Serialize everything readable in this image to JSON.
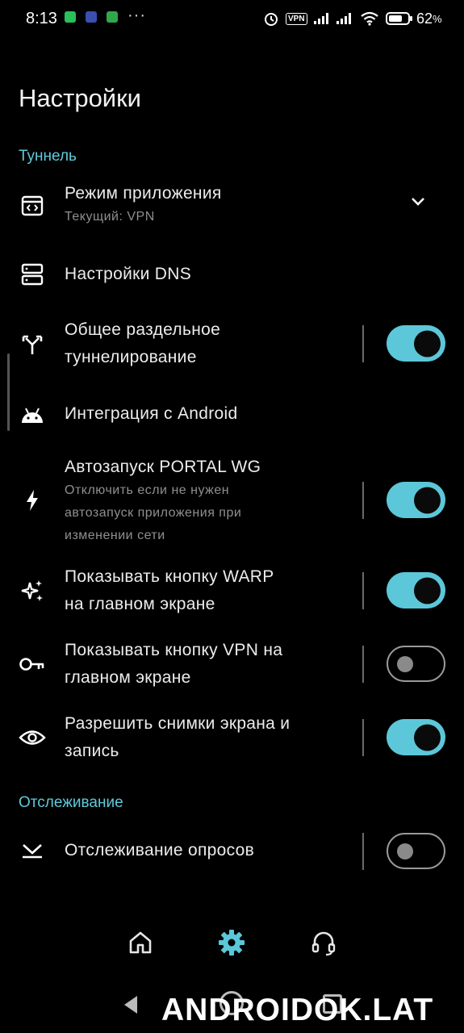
{
  "status_bar": {
    "time": "8:13",
    "more": "···",
    "vpn_badge": "VPN",
    "battery": "62",
    "battery_unit": "%",
    "notification_icons": [
      "whatsapp-icon",
      "network-icon",
      "app-icon"
    ],
    "right_icons": [
      "alarm-icon",
      "vpn-icon",
      "signal-icon",
      "signal-icon",
      "wifi-icon",
      "battery-icon"
    ]
  },
  "page": {
    "title": "Настройки"
  },
  "sections": {
    "tunnel": "Туннель",
    "tracking": "Отслеживание"
  },
  "rows": {
    "app_mode": {
      "title": "Режим приложения",
      "subtitle": "Текущий: VPN",
      "icon": "app-mode-icon"
    },
    "dns": {
      "title": "Настройки DNS",
      "icon": "dns-icon"
    },
    "split_tunnel": {
      "title_line1": "Общее раздельное",
      "title_line2": "туннелирование",
      "icon": "split-icon",
      "enabled": true
    },
    "android": {
      "title": "Интеграция с Android",
      "icon": "android-icon"
    },
    "autostart": {
      "title": "Автозапуск PORTAL WG",
      "sub_line1": "Отключить если не нужен",
      "sub_line2": "автозапуск приложения при",
      "sub_line3": "изменении сети",
      "icon": "bolt-icon",
      "enabled": true
    },
    "warp_button": {
      "title_line1": "Показывать кнопку WARP",
      "title_line2": "на главном экране",
      "icon": "sparkle-icon",
      "enabled": true
    },
    "vpn_button": {
      "title_line1": "Показывать кнопку VPN на",
      "title_line2": "главном экране",
      "icon": "key-icon",
      "enabled": false
    },
    "screenshots": {
      "title_line1": "Разрешить снимки экрана и",
      "title_line2": "запись",
      "icon": "eye-icon",
      "enabled": true
    },
    "poll_tracking": {
      "title": "Отслеживание опросов",
      "icon": "poll-icon",
      "enabled": false
    }
  },
  "bottom_nav": {
    "items": [
      {
        "name": "home",
        "icon": "home-icon",
        "active": false
      },
      {
        "name": "settings",
        "icon": "gear-icon",
        "active": true
      },
      {
        "name": "support",
        "icon": "headset-icon",
        "active": false
      }
    ]
  },
  "colors": {
    "accent": "#5cc7d8",
    "background": "#000000"
  },
  "watermark": "ANDROIDOK.LAT"
}
